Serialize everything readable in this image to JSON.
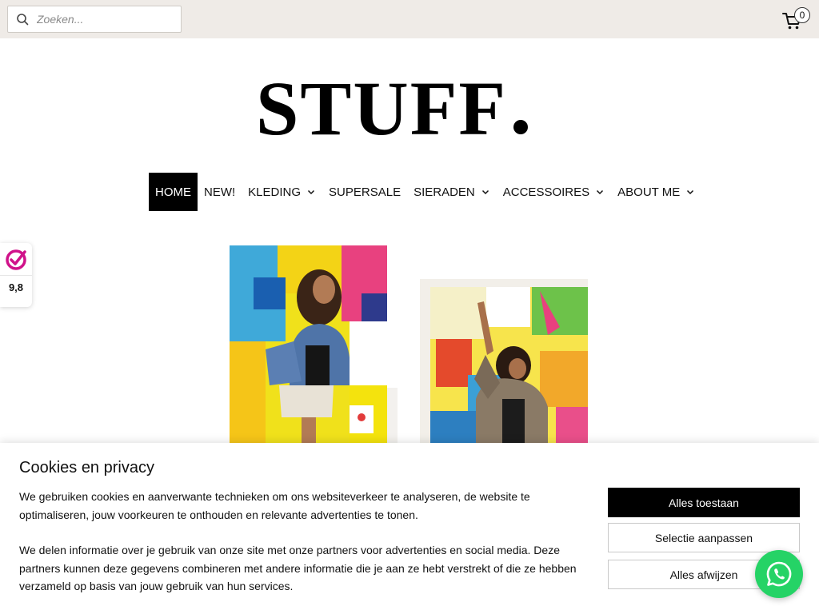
{
  "search": {
    "placeholder": "Zoeken..."
  },
  "cart": {
    "count": "0"
  },
  "logo": {
    "text": "STUFF"
  },
  "nav": {
    "items": [
      {
        "label": "HOME",
        "active": true,
        "dropdown": false
      },
      {
        "label": "NEW!",
        "active": false,
        "dropdown": false
      },
      {
        "label": "KLEDING",
        "active": false,
        "dropdown": true
      },
      {
        "label": "SUPERSALE",
        "active": false,
        "dropdown": false
      },
      {
        "label": "SIERADEN",
        "active": false,
        "dropdown": true
      },
      {
        "label": "ACCESSOIRES",
        "active": false,
        "dropdown": true
      },
      {
        "label": "ABOUT ME",
        "active": false,
        "dropdown": true
      }
    ]
  },
  "rating_badge": {
    "score": "9,8",
    "icon": "review-check-icon",
    "color": "#d0128a"
  },
  "cookie": {
    "title": "Cookies en privacy",
    "paragraph1": "We gebruiken cookies en aanverwante technieken om ons websiteverkeer te analyseren, de website te optimaliseren, jouw voorkeuren te onthouden en relevante advertenties te tonen.",
    "paragraph2": "We delen informatie over je gebruik van onze site met onze partners voor advertenties en social media. Deze partners kunnen deze gegevens combineren met andere informatie die je aan ze hebt verstrekt of die ze hebben verzameld op basis van jouw gebruik van hun services.",
    "accept_label": "Alles toestaan",
    "adjust_label": "Selectie aanpassen",
    "reject_label": "Alles afwijzen"
  },
  "colors": {
    "topbar": "#efebe7",
    "accent": "#000000",
    "whatsapp": "#25d366"
  }
}
